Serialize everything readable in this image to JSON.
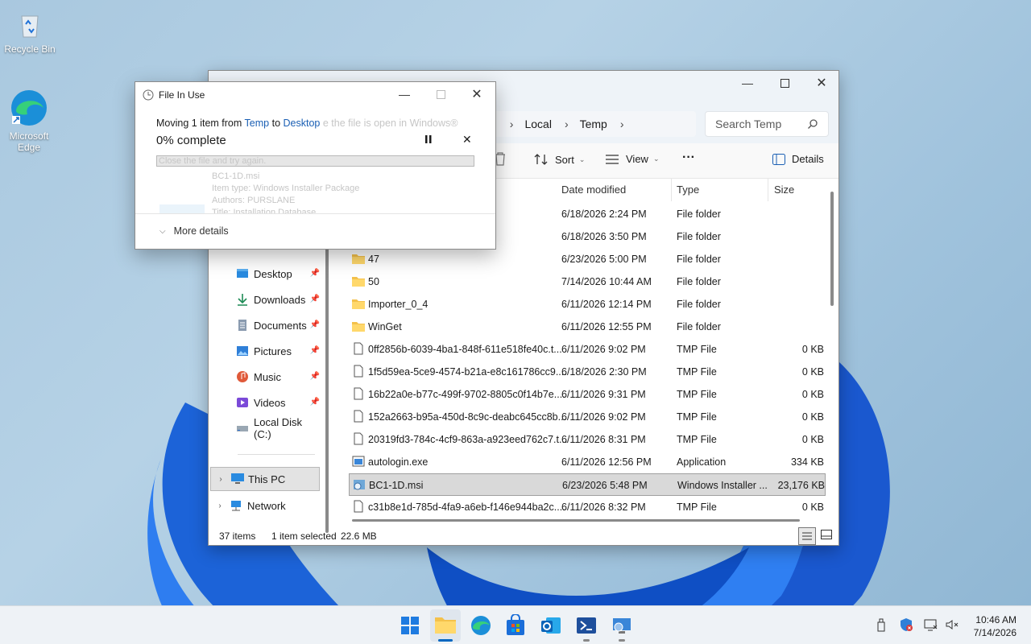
{
  "desktop": {
    "icons": [
      {
        "label": "Recycle Bin"
      },
      {
        "label": "Microsoft Edge"
      }
    ]
  },
  "explorer": {
    "breadcrumb": [
      "Local",
      "Temp"
    ],
    "breadcrumb_partial": "n",
    "search_placeholder": "Search Temp",
    "toolbar": {
      "sort": "Sort",
      "view": "View",
      "more": "···",
      "details": "Details"
    },
    "sidebar": {
      "quick": [
        {
          "label": "Desktop",
          "icon": "desktop-icon",
          "pinned": true
        },
        {
          "label": "Downloads",
          "icon": "download-icon",
          "pinned": true
        },
        {
          "label": "Documents",
          "icon": "documents-icon",
          "pinned": true
        },
        {
          "label": "Pictures",
          "icon": "pictures-icon",
          "pinned": true
        },
        {
          "label": "Music",
          "icon": "music-icon",
          "pinned": true
        },
        {
          "label": "Videos",
          "icon": "videos-icon",
          "pinned": true
        },
        {
          "label": "Local Disk (C:)",
          "icon": "drive-icon",
          "pinned": false
        }
      ],
      "groups": [
        {
          "label": "This PC",
          "selected": true
        },
        {
          "label": "Network",
          "selected": false
        }
      ]
    },
    "columns": {
      "date": "Date modified",
      "type": "Type",
      "size": "Size"
    },
    "files": [
      {
        "name": "",
        "date": "6/18/2026 2:24 PM",
        "type": "File folder",
        "size": "",
        "kind": "folder"
      },
      {
        "name": "",
        "date": "6/18/2026 3:50 PM",
        "type": "File folder",
        "size": "",
        "kind": "folder"
      },
      {
        "name": "47",
        "date": "6/23/2026 5:00 PM",
        "type": "File folder",
        "size": "",
        "kind": "folder"
      },
      {
        "name": "50",
        "date": "7/14/2026 10:44 AM",
        "type": "File folder",
        "size": "",
        "kind": "folder"
      },
      {
        "name": "Importer_0_4",
        "date": "6/11/2026 12:14 PM",
        "type": "File folder",
        "size": "",
        "kind": "folder"
      },
      {
        "name": "WinGet",
        "date": "6/11/2026 12:55 PM",
        "type": "File folder",
        "size": "",
        "kind": "folder"
      },
      {
        "name": "0ff2856b-6039-4ba1-848f-611e518fe40c.t...",
        "date": "6/11/2026 9:02 PM",
        "type": "TMP File",
        "size": "0 KB",
        "kind": "file"
      },
      {
        "name": "1f5d59ea-5ce9-4574-b21a-e8c161786cc9....",
        "date": "6/18/2026 2:30 PM",
        "type": "TMP File",
        "size": "0 KB",
        "kind": "file"
      },
      {
        "name": "16b22a0e-b77c-499f-9702-8805c0f14b7e....",
        "date": "6/11/2026 9:31 PM",
        "type": "TMP File",
        "size": "0 KB",
        "kind": "file"
      },
      {
        "name": "152a2663-b95a-450d-8c9c-deabc645cc8b...",
        "date": "6/11/2026 9:02 PM",
        "type": "TMP File",
        "size": "0 KB",
        "kind": "file"
      },
      {
        "name": "20319fd3-784c-4cf9-863a-a923eed762c7.t...",
        "date": "6/11/2026 8:31 PM",
        "type": "TMP File",
        "size": "0 KB",
        "kind": "file"
      },
      {
        "name": "autologin.exe",
        "date": "6/11/2026 12:56 PM",
        "type": "Application",
        "size": "334 KB",
        "kind": "exe"
      },
      {
        "name": "BC1-1D.msi",
        "date": "6/23/2026 5:48 PM",
        "type": "Windows Installer ...",
        "size": "23,176 KB",
        "kind": "msi",
        "selected": true
      },
      {
        "name": "c31b8e1d-785d-4fa9-a6eb-f146e944ba2c....",
        "date": "6/11/2026 8:32 PM",
        "type": "TMP File",
        "size": "0 KB",
        "kind": "file"
      }
    ],
    "status": {
      "count": "37 items",
      "selected": "1 item selected",
      "size": "22.6 MB"
    }
  },
  "dialog": {
    "title": "File In Use",
    "moving_prefix": "Moving 1 item from",
    "from": "Temp",
    "to_word": "to",
    "to": "Desktop",
    "ghost_line1": "e the file is open in Windows®",
    "percent": "0% complete",
    "ghost_line2": "Close the file and try again.",
    "ghost_file": "BC1-1D.msi",
    "ghost_type": "Item type: Windows Installer Package",
    "ghost_authors": "Authors: PURSLANE",
    "ghost_title": "Title: Installation Database",
    "more_details": "More details",
    "progress": 0
  },
  "taskbar": {
    "time": "10:46 AM",
    "date": "7/14/2026"
  },
  "colors": {
    "accent": "#0067c0",
    "link": "#1a5fb4",
    "folder": "#f4c14b"
  }
}
